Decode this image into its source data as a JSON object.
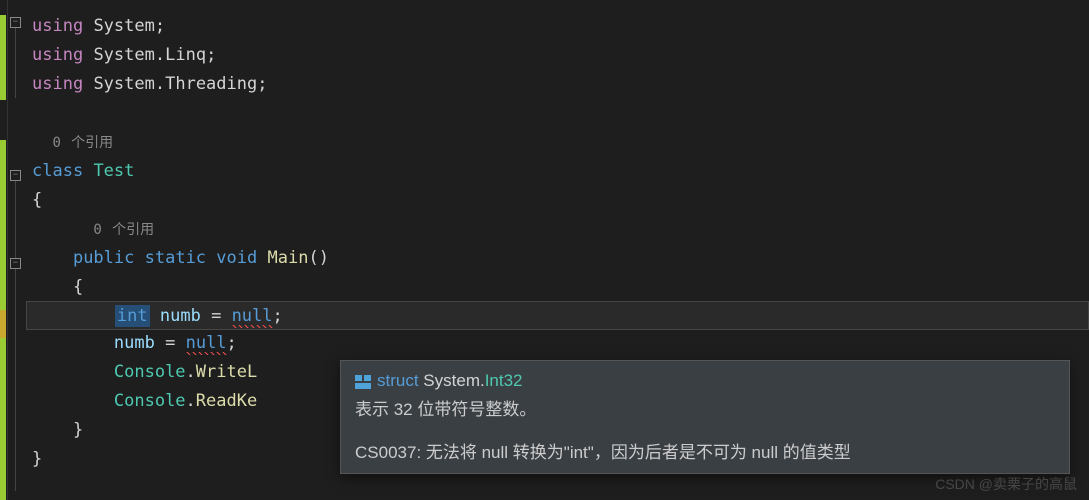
{
  "code": {
    "using1_kw": "using",
    "using1_ns": "System",
    "using2_kw": "using",
    "using2_ns1": "System",
    "using2_ns2": "Linq",
    "using3_kw": "using",
    "using3_ns1": "System",
    "using3_ns2": "Threading",
    "ref1_count": "0",
    "ref1_label": "个引用",
    "class_kw": "class",
    "class_name": "Test",
    "brace_open": "{",
    "ref2_count": "0",
    "ref2_label": "个引用",
    "sig_public": "public",
    "sig_static": "static",
    "sig_void": "void",
    "sig_method": "Main",
    "sig_parens": "()",
    "body_open": "{",
    "line1_type": "int",
    "line1_var": "numb",
    "line1_eq": "=",
    "line1_null": "null",
    "line1_semi": ";",
    "line2_var": "numb",
    "line2_eq": "=",
    "line2_null": "null",
    "line2_semi": ";",
    "line3_obj": "Console",
    "line3_m": "WriteL",
    "line4_obj": "Console",
    "line4_m": "ReadKe",
    "body_close": "}",
    "class_close": "}"
  },
  "tooltip": {
    "struct_kw": "struct",
    "namespace": "System.",
    "type_name": "Int32",
    "description": "表示 32 位带符号整数。",
    "error_code": "CS0037",
    "error_msg": ": 无法将 null 转换为\"int\"，因为后者是不可为 null 的值类型"
  },
  "watermark": "CSDN @卖栗子的高鼠"
}
